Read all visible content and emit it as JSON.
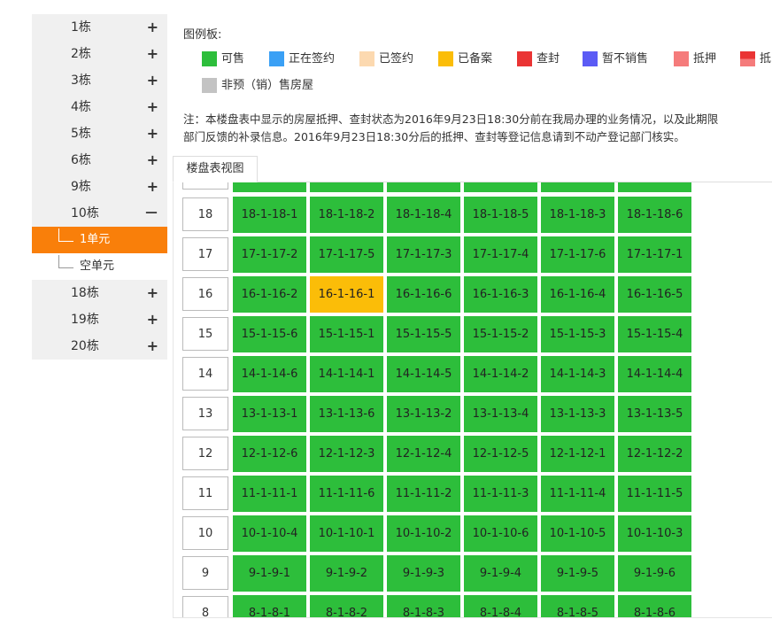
{
  "sidebar": {
    "buildings": [
      {
        "label": "1栋",
        "sign": "+"
      },
      {
        "label": "2栋",
        "sign": "+"
      },
      {
        "label": "3栋",
        "sign": "+"
      },
      {
        "label": "4栋",
        "sign": "+"
      },
      {
        "label": "5栋",
        "sign": "+"
      },
      {
        "label": "6栋",
        "sign": "+"
      },
      {
        "label": "9栋",
        "sign": "+"
      },
      {
        "label": "10栋",
        "sign": "－"
      }
    ],
    "units": [
      {
        "label": "1单元",
        "active": true
      },
      {
        "label": "空单元",
        "active": false
      }
    ],
    "buildings_after": [
      {
        "label": "18栋",
        "sign": "+"
      },
      {
        "label": "19栋",
        "sign": "+"
      },
      {
        "label": "20栋",
        "sign": "+"
      }
    ]
  },
  "legend": {
    "title": "图例板:",
    "items": [
      {
        "label": "可售",
        "color": "#2dbe3b"
      },
      {
        "label": "正在签约",
        "color": "#3aa0f5"
      },
      {
        "label": "已签约",
        "color": "#fcd9b0"
      },
      {
        "label": "已备案",
        "color": "#fbbd08"
      },
      {
        "label": "查封",
        "color": "#ea3434"
      },
      {
        "label": "暂不销售",
        "color": "#5b5bf5"
      },
      {
        "label": "抵押",
        "color": "#f57b7b"
      },
      {
        "label": "抵",
        "color": "#ea3434"
      },
      {
        "label": "非预（销）售房屋",
        "color": "#c3c3c3"
      }
    ]
  },
  "note": {
    "line1": "注：本楼盘表中显示的房屋抵押、查封状态为2016年9月23日18:30分前在我局办理的业务情况，以及此期限",
    "line2": "部门反馈的补录信息。2016年9月23日18:30分后的抵押、查封等登记信息请到不动产登记部门核实。"
  },
  "tab": {
    "label": "楼盘表视图"
  },
  "grid": {
    "colors": {
      "available": "#2dbe3b",
      "filed": "#fbbd08"
    },
    "floors": [
      {
        "floor": "18",
        "units": [
          {
            "id": "18-1-18-1",
            "status": "available"
          },
          {
            "id": "18-1-18-2",
            "status": "available"
          },
          {
            "id": "18-1-18-4",
            "status": "available"
          },
          {
            "id": "18-1-18-5",
            "status": "available"
          },
          {
            "id": "18-1-18-3",
            "status": "available"
          },
          {
            "id": "18-1-18-6",
            "status": "available"
          }
        ]
      },
      {
        "floor": "17",
        "units": [
          {
            "id": "17-1-17-2",
            "status": "available"
          },
          {
            "id": "17-1-17-5",
            "status": "available"
          },
          {
            "id": "17-1-17-3",
            "status": "available"
          },
          {
            "id": "17-1-17-4",
            "status": "available"
          },
          {
            "id": "17-1-17-6",
            "status": "available"
          },
          {
            "id": "17-1-17-1",
            "status": "available"
          }
        ]
      },
      {
        "floor": "16",
        "units": [
          {
            "id": "16-1-16-2",
            "status": "available"
          },
          {
            "id": "16-1-16-1",
            "status": "filed"
          },
          {
            "id": "16-1-16-6",
            "status": "available"
          },
          {
            "id": "16-1-16-3",
            "status": "available"
          },
          {
            "id": "16-1-16-4",
            "status": "available"
          },
          {
            "id": "16-1-16-5",
            "status": "available"
          }
        ]
      },
      {
        "floor": "15",
        "units": [
          {
            "id": "15-1-15-6",
            "status": "available"
          },
          {
            "id": "15-1-15-1",
            "status": "available"
          },
          {
            "id": "15-1-15-5",
            "status": "available"
          },
          {
            "id": "15-1-15-2",
            "status": "available"
          },
          {
            "id": "15-1-15-3",
            "status": "available"
          },
          {
            "id": "15-1-15-4",
            "status": "available"
          }
        ]
      },
      {
        "floor": "14",
        "units": [
          {
            "id": "14-1-14-6",
            "status": "available"
          },
          {
            "id": "14-1-14-1",
            "status": "available"
          },
          {
            "id": "14-1-14-5",
            "status": "available"
          },
          {
            "id": "14-1-14-2",
            "status": "available"
          },
          {
            "id": "14-1-14-3",
            "status": "available"
          },
          {
            "id": "14-1-14-4",
            "status": "available"
          }
        ]
      },
      {
        "floor": "13",
        "units": [
          {
            "id": "13-1-13-1",
            "status": "available"
          },
          {
            "id": "13-1-13-6",
            "status": "available"
          },
          {
            "id": "13-1-13-2",
            "status": "available"
          },
          {
            "id": "13-1-13-4",
            "status": "available"
          },
          {
            "id": "13-1-13-3",
            "status": "available"
          },
          {
            "id": "13-1-13-5",
            "status": "available"
          }
        ]
      },
      {
        "floor": "12",
        "units": [
          {
            "id": "12-1-12-6",
            "status": "available"
          },
          {
            "id": "12-1-12-3",
            "status": "available"
          },
          {
            "id": "12-1-12-4",
            "status": "available"
          },
          {
            "id": "12-1-12-5",
            "status": "available"
          },
          {
            "id": "12-1-12-1",
            "status": "available"
          },
          {
            "id": "12-1-12-2",
            "status": "available"
          }
        ]
      },
      {
        "floor": "11",
        "units": [
          {
            "id": "11-1-11-1",
            "status": "available"
          },
          {
            "id": "11-1-11-6",
            "status": "available"
          },
          {
            "id": "11-1-11-2",
            "status": "available"
          },
          {
            "id": "11-1-11-3",
            "status": "available"
          },
          {
            "id": "11-1-11-4",
            "status": "available"
          },
          {
            "id": "11-1-11-5",
            "status": "available"
          }
        ]
      },
      {
        "floor": "10",
        "units": [
          {
            "id": "10-1-10-4",
            "status": "available"
          },
          {
            "id": "10-1-10-1",
            "status": "available"
          },
          {
            "id": "10-1-10-2",
            "status": "available"
          },
          {
            "id": "10-1-10-6",
            "status": "available"
          },
          {
            "id": "10-1-10-5",
            "status": "available"
          },
          {
            "id": "10-1-10-3",
            "status": "available"
          }
        ]
      },
      {
        "floor": "9",
        "units": [
          {
            "id": "9-1-9-1",
            "status": "available"
          },
          {
            "id": "9-1-9-2",
            "status": "available"
          },
          {
            "id": "9-1-9-3",
            "status": "available"
          },
          {
            "id": "9-1-9-4",
            "status": "available"
          },
          {
            "id": "9-1-9-5",
            "status": "available"
          },
          {
            "id": "9-1-9-6",
            "status": "available"
          }
        ]
      },
      {
        "floor": "8",
        "units": [
          {
            "id": "8-1-8-1",
            "status": "available"
          },
          {
            "id": "8-1-8-2",
            "status": "available"
          },
          {
            "id": "8-1-8-3",
            "status": "available"
          },
          {
            "id": "8-1-8-4",
            "status": "available"
          },
          {
            "id": "8-1-8-5",
            "status": "available"
          },
          {
            "id": "8-1-8-6",
            "status": "available"
          }
        ]
      }
    ]
  }
}
